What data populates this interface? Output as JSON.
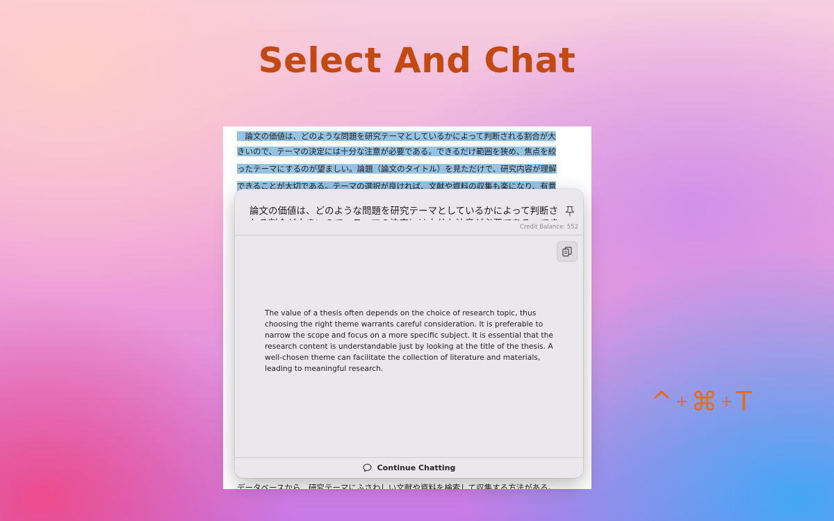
{
  "headline": "Select And Chat",
  "document": {
    "lines": [
      "　論文の価値は、どのような問題を研究テーマとしているかによって判断される割合が大",
      "きいので、テーマの決定には十分な注意が必要である。できるだけ範囲を狭め、焦点を絞",
      "ったテーマにするのが望ましい。論題（論文のタイトル）を見ただけで、研究内容が理解",
      "できることが大切である。テーマの選択が良ければ、文献や資料の収集も楽になり、有意"
    ],
    "bottom_line": "データベースから、研究テーマにふさわしい文献や資料を検索して収集する方法がある。"
  },
  "popup": {
    "selected_text": "論文の価値は、どのような問題を研究テーマとしているかによって判断される割合が大きいので、テーマの決定には十分な注意が必要である。できるだけ範囲を狭め",
    "credit_balance": "Credit Balance: 552",
    "answer": "The value of a thesis often depends on the choice of research topic, thus choosing the right theme warrants careful consideration. It is preferable to narrow the scope and focus on a more specific subject. It is essential that the research content is understandable just by looking at the title of the thesis. A well-chosen theme can facilitate the collection of literature and materials, leading to meaningful research.",
    "continue_label": "Continue Chatting"
  },
  "shortcut": {
    "keys": [
      "^",
      "⌘",
      "T"
    ],
    "separator": "+"
  },
  "colors": {
    "headline": "#c24a12",
    "highlight": "#97c3e2",
    "shortcut": "#e06f1e"
  }
}
